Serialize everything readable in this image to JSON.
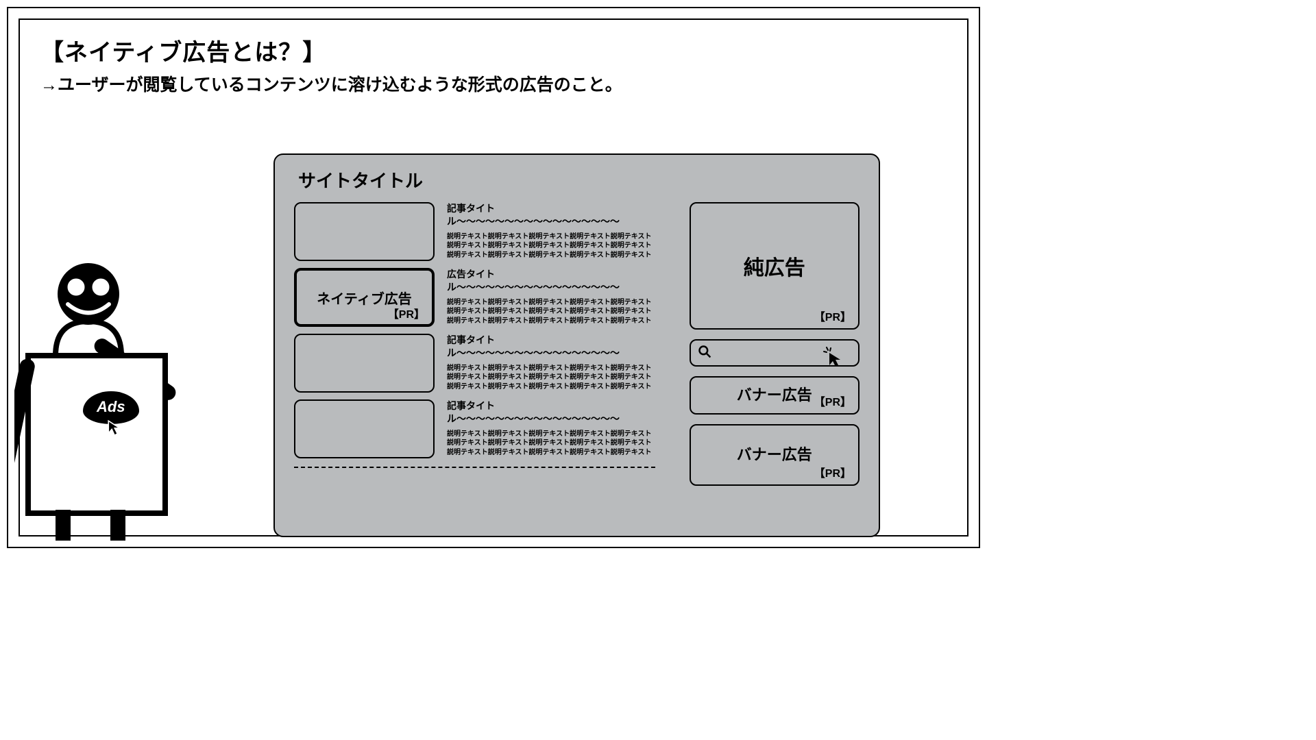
{
  "heading": "【ネイティブ広告とは？】",
  "subheading": "→ユーザーが閲覧しているコンテンツに溶け込むような形式の広告のこと。",
  "site": {
    "title": "サイトタイトル",
    "pr_label": "【PR】",
    "native_ad_label": "ネイティブ広告",
    "feed": [
      {
        "title": "記事タイトル〜〜〜〜〜〜〜〜〜〜〜〜〜〜〜〜〜",
        "desc": "説明テキスト説明テキスト説明テキスト説明テキスト説明テキスト説明テキスト説明テキスト説明テキスト説明テキスト説明テキスト説明テキスト説明テキスト説明テキスト説明テキスト説明テキスト"
      },
      {
        "title": "広告タイトル〜〜〜〜〜〜〜〜〜〜〜〜〜〜〜〜〜",
        "desc": "説明テキスト説明テキスト説明テキスト説明テキスト説明テキスト説明テキスト説明テキスト説明テキスト説明テキスト説明テキスト説明テキスト説明テキスト説明テキスト説明テキスト説明テキスト"
      },
      {
        "title": "記事タイトル〜〜〜〜〜〜〜〜〜〜〜〜〜〜〜〜〜",
        "desc": "説明テキスト説明テキスト説明テキスト説明テキスト説明テキスト説明テキスト説明テキスト説明テキスト説明テキスト説明テキスト説明テキスト説明テキスト説明テキスト説明テキスト説明テキスト"
      },
      {
        "title": "記事タイトル〜〜〜〜〜〜〜〜〜〜〜〜〜〜〜〜〜",
        "desc": "説明テキスト説明テキスト説明テキスト説明テキスト説明テキスト説明テキスト説明テキスト説明テキスト説明テキスト説明テキスト説明テキスト説明テキスト説明テキスト説明テキスト説明テキスト"
      }
    ],
    "sidebar": {
      "display_ad": "純広告",
      "banner1": "バナー広告",
      "banner2": "バナー広告"
    }
  },
  "mascot": {
    "badge": "Ads"
  }
}
